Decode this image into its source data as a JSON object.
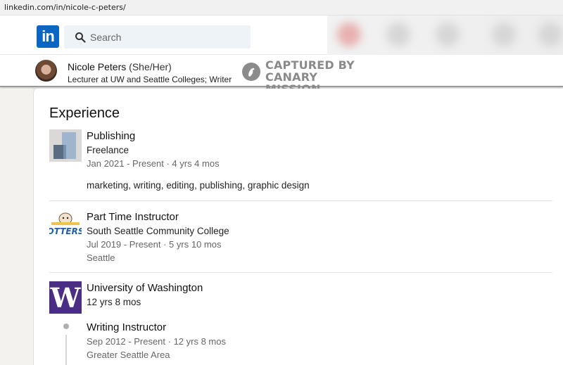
{
  "browser": {
    "url": "linkedin.com/in/nicole-c-peters/"
  },
  "nav": {
    "logo_text": "in",
    "search_placeholder": "Search"
  },
  "profile": {
    "name": "Nicole Peters",
    "pronouns": "(She/Her)",
    "headline": "Lecturer at UW and Seattle Colleges; Writer"
  },
  "watermark": {
    "line1": "CAPTURED BY",
    "line2": "CANARY MISSION"
  },
  "experience": {
    "section_title": "Experience",
    "entries": [
      {
        "title": "Publishing",
        "company": "Freelance",
        "dates": "Jan 2021 - Present · 4 yrs 4 mos",
        "description": "marketing, writing, editing, publishing, graphic design"
      },
      {
        "title": "Part Time Instructor",
        "company": "South Seattle Community College",
        "dates": "Jul 2019 - Present · 5 yrs 10 mos",
        "location": "Seattle",
        "logo_text": "OTTERS"
      },
      {
        "company": "University of Washington",
        "duration": "12 yrs 8 mos",
        "logo_text": "W",
        "roles": [
          {
            "title": "Writing Instructor",
            "dates": "Sep 2012 - Present · 12 yrs 8 mos",
            "location": "Greater Seattle Area"
          }
        ]
      }
    ]
  },
  "colors": {
    "linkedin_blue": "#0a66c2",
    "uw_purple": "#4b2e83",
    "search_bg": "#eef3f8"
  }
}
